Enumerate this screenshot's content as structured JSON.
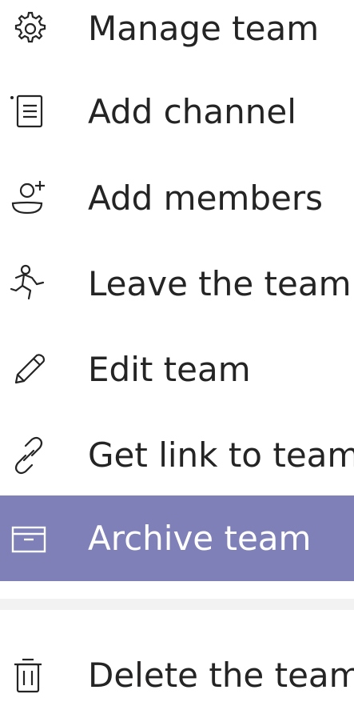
{
  "menu": {
    "items": [
      {
        "label": "Manage team",
        "icon": "gear-icon"
      },
      {
        "label": "Add channel",
        "icon": "channel-list-icon"
      },
      {
        "label": "Add members",
        "icon": "add-person-icon"
      },
      {
        "label": "Leave the team",
        "icon": "running-person-icon"
      },
      {
        "label": "Edit team",
        "icon": "pencil-icon"
      },
      {
        "label": "Get link to team",
        "icon": "link-icon"
      },
      {
        "label": "Archive team",
        "icon": "archive-box-icon",
        "selected": true
      },
      {
        "label": "Delete the team",
        "icon": "trash-icon"
      }
    ]
  },
  "colors": {
    "selected_background": "#7f80b8",
    "text": "#252424",
    "selected_text": "#ffffff",
    "divider": "#f2f2f2"
  }
}
